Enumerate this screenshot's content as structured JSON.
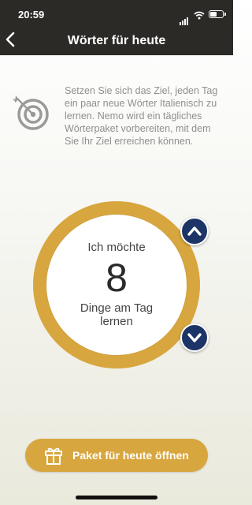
{
  "status_bar": {
    "time": "20:59"
  },
  "nav": {
    "title": "Wörter für heute",
    "back_icon": "chevron-left-icon"
  },
  "intro": {
    "icon": "target-icon",
    "text": "Setzen Sie sich das Ziel, jeden Tag ein paar neue Wörter Italienisch zu lernen. Nemo wird ein tägliches Wörterpaket vorbereiten, mit dem Sie Ihr Ziel erreichen können."
  },
  "goal": {
    "prefix": "Ich möchte",
    "value": "8",
    "suffix": "Dinge am Tag lernen"
  },
  "cta": {
    "label": "Paket für heute öffnen",
    "icon": "gift-icon"
  },
  "colors": {
    "accent": "#d8a63e",
    "stepper": "#1d3466",
    "topbar": "#2b2a27"
  }
}
